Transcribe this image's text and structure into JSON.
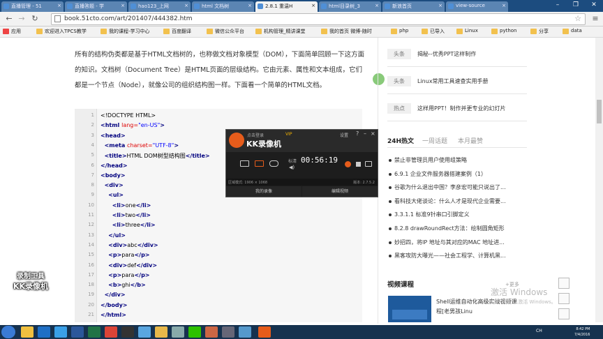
{
  "browser": {
    "tabs": [
      {
        "label": "直播管理 - 51",
        "active": false
      },
      {
        "label": "直播答题 - 学",
        "active": false
      },
      {
        "label": "hao123_上网",
        "active": false
      },
      {
        "label": "html 文档树",
        "active": false
      },
      {
        "label": "2.8.1   重温H",
        "active": true
      },
      {
        "label": "html目录树_3",
        "active": false
      },
      {
        "label": "新浪首页",
        "active": false
      },
      {
        "label": "view-source",
        "active": false
      }
    ],
    "url": "book.51cto.com/art/201407/444382.htm",
    "bookmarks": [
      "应用",
      "欢迎进入TPCS教学",
      "我的课程-学习中心",
      "百度翻译",
      "微信公众平台",
      "机构管理_精讲课堂",
      "我的首页 微博-随时",
      "php",
      "已导入",
      "Linux",
      "python",
      "分享",
      "data"
    ]
  },
  "article": {
    "paragraph": "所有的结构伪类都是基于HTML文档树的，也称做文档对象模型（DOM），下面简单回顾一下这方面的知识。文档树（Document Tree）是HTML页面的层级结构。它由元素、属性和文本组成，它们都是一个节点（Node），就像公司的组织结构图一样。下面看一个简单的HTML文档。",
    "code_lines": [
      {
        "n": "1",
        "parts": [
          {
            "t": "<!DOCTYPE HTML>",
            "c": ""
          }
        ]
      },
      {
        "n": "2",
        "parts": [
          {
            "t": "<html ",
            "c": "t"
          },
          {
            "t": "lang=",
            "c": "a"
          },
          {
            "t": "\"en-US\"",
            "c": "v"
          },
          {
            "t": ">",
            "c": "t"
          }
        ]
      },
      {
        "n": "3",
        "parts": [
          {
            "t": "<head>",
            "c": "t"
          }
        ]
      },
      {
        "n": "4",
        "parts": [
          {
            "t": "  <meta ",
            "c": "t"
          },
          {
            "t": "charset=",
            "c": "a"
          },
          {
            "t": "\"UTF-8\"",
            "c": "v"
          },
          {
            "t": ">",
            "c": "t"
          }
        ]
      },
      {
        "n": "5",
        "parts": [
          {
            "t": "  <title>",
            "c": "t"
          },
          {
            "t": "HTML DOM树型结构图",
            "c": ""
          },
          {
            "t": "</title>",
            "c": "t"
          }
        ]
      },
      {
        "n": "6",
        "parts": [
          {
            "t": "</head>",
            "c": "t"
          }
        ]
      },
      {
        "n": "7",
        "parts": [
          {
            "t": "<body>",
            "c": "t"
          }
        ]
      },
      {
        "n": "8",
        "parts": [
          {
            "t": "  <div>",
            "c": "t"
          }
        ]
      },
      {
        "n": "9",
        "parts": [
          {
            "t": "    <ul>",
            "c": "t"
          }
        ]
      },
      {
        "n": "10",
        "parts": [
          {
            "t": "      <li>",
            "c": "t"
          },
          {
            "t": "one",
            "c": ""
          },
          {
            "t": "</li>",
            "c": "t"
          }
        ]
      },
      {
        "n": "11",
        "parts": [
          {
            "t": "      <li>",
            "c": "t"
          },
          {
            "t": "two",
            "c": ""
          },
          {
            "t": "</li>",
            "c": "t"
          }
        ]
      },
      {
        "n": "12",
        "parts": [
          {
            "t": "      <li>",
            "c": "t"
          },
          {
            "t": "three",
            "c": ""
          },
          {
            "t": "</li>",
            "c": "t"
          }
        ]
      },
      {
        "n": "13",
        "parts": [
          {
            "t": "    </ul>",
            "c": "t"
          }
        ]
      },
      {
        "n": "14",
        "parts": [
          {
            "t": "    <div>",
            "c": "t"
          },
          {
            "t": "abc",
            "c": ""
          },
          {
            "t": "</div>",
            "c": "t"
          }
        ]
      },
      {
        "n": "15",
        "parts": [
          {
            "t": "    <p>",
            "c": "t"
          },
          {
            "t": "para",
            "c": ""
          },
          {
            "t": "</p>",
            "c": "t"
          }
        ]
      },
      {
        "n": "16",
        "parts": [
          {
            "t": "    <div>",
            "c": "t"
          },
          {
            "t": "def",
            "c": ""
          },
          {
            "t": "</div>",
            "c": "t"
          }
        ]
      },
      {
        "n": "17",
        "parts": [
          {
            "t": "    <p>",
            "c": "t"
          },
          {
            "t": "para",
            "c": ""
          },
          {
            "t": "</p>",
            "c": "t"
          }
        ]
      },
      {
        "n": "18",
        "parts": [
          {
            "t": "    <b>",
            "c": "t"
          },
          {
            "t": "ghi",
            "c": ""
          },
          {
            "t": "</b>",
            "c": "t"
          }
        ]
      },
      {
        "n": "19",
        "parts": [
          {
            "t": "  </div>",
            "c": "t"
          }
        ]
      },
      {
        "n": "20",
        "parts": [
          {
            "t": "</body>",
            "c": "t"
          }
        ]
      },
      {
        "n": "21",
        "parts": [
          {
            "t": "</html>",
            "c": "t"
          }
        ]
      }
    ]
  },
  "sidebar": {
    "headlines": [
      {
        "tag": "头条",
        "text": "揭秘--优秀PPT这样制作"
      },
      {
        "tag": "头条",
        "text": "Linux常用工具速查实用手册"
      },
      {
        "tag": "热点",
        "text": "这样用PPT！制作并更专业的幻灯片"
      }
    ],
    "hot_tabs": [
      "24H热文",
      "一周话题",
      "本月最赞"
    ],
    "news": [
      "禁止非管理员用户使用组策略",
      "6.9.1 企业文件服务器搭建案例（1）",
      "谷歌为什么退出中国？李彦宏可能只说出了...",
      "看科技大佬谈论：什么人才是现代企业需要...",
      "3.3.1.1   标准9针串口引脚定义",
      "8.2.8 drawRoundRect方法：绘制圆角矩形",
      "妙招四，将IP 地址与其对应的MAC 地址进...",
      "黑客攻防大曝光——社会工程学、计算机黑..."
    ],
    "video_title": "视频课程",
    "video_more": "+更多",
    "video_caption": "Shell运维自动化高级实战视频课程[老男孩Linu"
  },
  "activate_windows": {
    "line1": "激活 Windows",
    "line2": "转到“设置”以激活 Windows。"
  },
  "kk_recorder": {
    "login": "点击登录",
    "vip": "VIP",
    "settings": "设置",
    "help": "?",
    "minimize": "–",
    "close": "×",
    "app_name": "KK录像机",
    "quality": "标清",
    "timer": "00:56:19",
    "area_mode": "区域模式: 1906 × 1068",
    "version": "版本: 2.7.5.2",
    "my_recordings": "我的录像",
    "edit_video": "编辑视频"
  },
  "watermark": {
    "line1": "录制工具",
    "line2": "KK录像机"
  },
  "taskbar": {
    "language": "CH",
    "time": "8:42 PM",
    "date": "7/4/2016"
  },
  "colors": {
    "titlebar": "#1c4c7f",
    "taskbar": "#16324f",
    "kk_accent": "#e65c1b",
    "code_tag": "#00007f",
    "code_attr": "#dd0000",
    "code_value": "#0000ff"
  }
}
